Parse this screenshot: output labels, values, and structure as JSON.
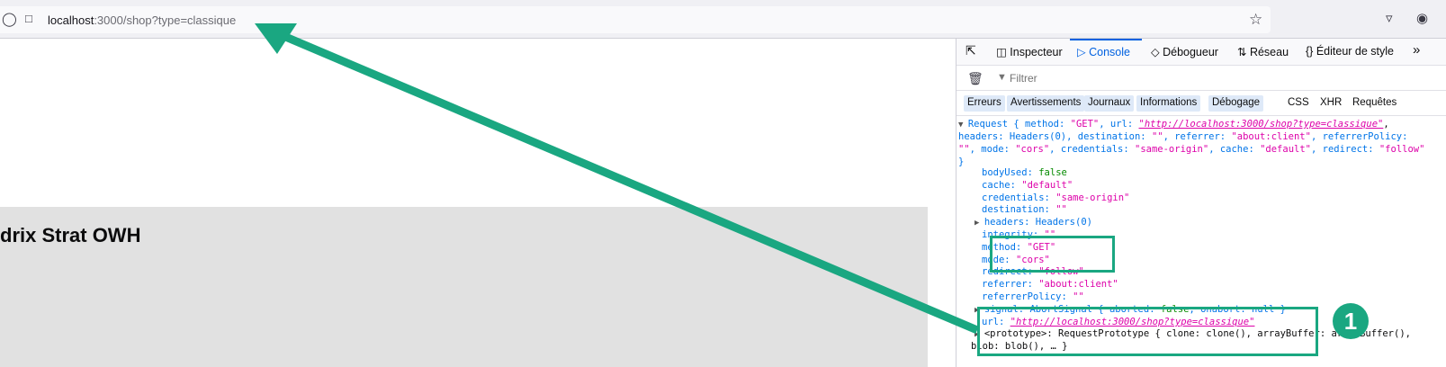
{
  "browser": {
    "url_host": "localhost",
    "url_rest": ":3000/shop?type=classique"
  },
  "page": {
    "panel_title": "drix Strat OWH"
  },
  "devtools": {
    "tabs": [
      {
        "label": "Inspecteur",
        "icon": "inspector-icon"
      },
      {
        "label": "Console",
        "icon": "console-icon",
        "active": true
      },
      {
        "label": "Débogueur",
        "icon": "debugger-icon"
      },
      {
        "label": "Réseau",
        "icon": "network-icon"
      },
      {
        "label": "Éditeur de style",
        "icon": "style-editor-icon"
      }
    ],
    "filter_placeholder": "Filtrer",
    "categories": [
      "Erreurs",
      "Avertissements",
      "Journaux",
      "Informations",
      "Débogage"
    ],
    "extra_filters": [
      "CSS",
      "XHR",
      "Requêtes"
    ]
  },
  "console": {
    "summary_prefix": "Request { method: ",
    "method_val": "\"GET\"",
    "url_label": ", url: ",
    "url_val": "\"http://localhost:3000/shop?type=classique\"",
    "summary_line2a": "headers: Headers(0), destination: ",
    "summary_line2b": "\"\"",
    "summary_line2c": ", referrer: ",
    "summary_line2d": "\"about:client\"",
    "summary_line2e": ", referrerPolicy:",
    "summary_line3a": "\"\"",
    "summary_line3b": ", mode: ",
    "summary_line3c": "\"cors\"",
    "summary_line3d": ", credentials: ",
    "summary_line3e": "\"same-origin\"",
    "summary_line3f": ", cache: ",
    "summary_line3g": "\"default\"",
    "summary_line3h": ", redirect: ",
    "summary_line3i": "\"follow\"",
    "close_brace": "}",
    "props": {
      "bodyUsed_key": "bodyUsed:",
      "bodyUsed_val": "false",
      "cache_key": "cache:",
      "cache_val": "\"default\"",
      "credentials_key": "credentials:",
      "credentials_val": "\"same-origin\"",
      "destination_key": "destination:",
      "destination_val": "\"\"",
      "headers_key": "headers:",
      "headers_val": "Headers(0)",
      "integrity_key": "integrity:",
      "integrity_val": "\"\"",
      "method_key": "method:",
      "method_val": "\"GET\"",
      "mode_key": "mode:",
      "mode_val": "\"cors\"",
      "redirect_key": "redirect:",
      "redirect_val": "\"follow\"",
      "referrer_key": "referrer:",
      "referrer_val": "\"about:client\"",
      "referrerPolicy_key": "referrerPolicy:",
      "referrerPolicy_val": "\"\"",
      "signal_key": "signal:",
      "signal_val_a": "AbortSignal { aborted: ",
      "signal_val_b": "false",
      "signal_val_c": ", onabort: null }",
      "url_key": "url:",
      "url_val": "\"http://localhost:3000/shop?type=classique\"",
      "prototype_key": "<prototype>:",
      "prototype_val": "RequestPrototype { clone: clone(), arrayBuffer: arrayBuffer(),",
      "prototype_val2": "blob: blob(), … }"
    }
  },
  "annotation": {
    "badge_number": "1",
    "accent_color": "#1aa781"
  }
}
